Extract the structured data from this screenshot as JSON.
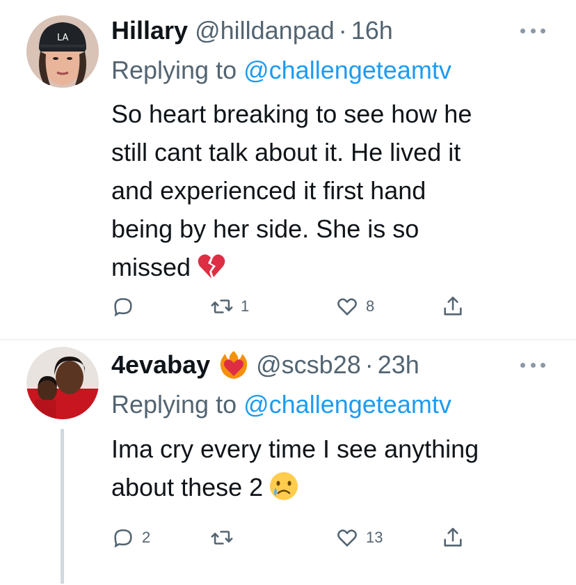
{
  "tweets": [
    {
      "author_name": "Hillary",
      "handle": "@hilldanpad",
      "separator": "·",
      "time": "16h",
      "replying_prefix": "Replying to ",
      "replying_to": "@challengeteamtv",
      "body_lines": [
        "So heart breaking to see how he",
        "still cant talk about it. He lived it",
        "and experienced it first hand",
        "being by her side. She is so",
        "missed"
      ],
      "body_emoji": "broken-heart-emoji",
      "reply_count": "",
      "retweet_count": "1",
      "like_count": "8",
      "avatar": "user-avatar-hillary"
    },
    {
      "author_name": "4evabay",
      "name_emoji": "heart-on-fire-emoji",
      "handle": "@scsb28",
      "separator": "·",
      "time": "23h",
      "replying_prefix": "Replying to ",
      "replying_to": "@challengeteamtv",
      "body_lines": [
        "Ima cry every time I see anything",
        "about these 2"
      ],
      "body_emoji": "crying-face-emoji",
      "reply_count": "2",
      "retweet_count": "",
      "like_count": "13",
      "avatar": "user-avatar-4evabay"
    }
  ],
  "colors": {
    "text_primary": "#0f1419",
    "text_secondary": "#536471",
    "link": "#1d9bf0",
    "thread_line": "#cfd9de",
    "divider": "#eff3f4"
  },
  "icons": {
    "reply": "reply-icon",
    "retweet": "retweet-icon",
    "like": "like-icon",
    "share": "share-icon",
    "more": "more-icon"
  }
}
